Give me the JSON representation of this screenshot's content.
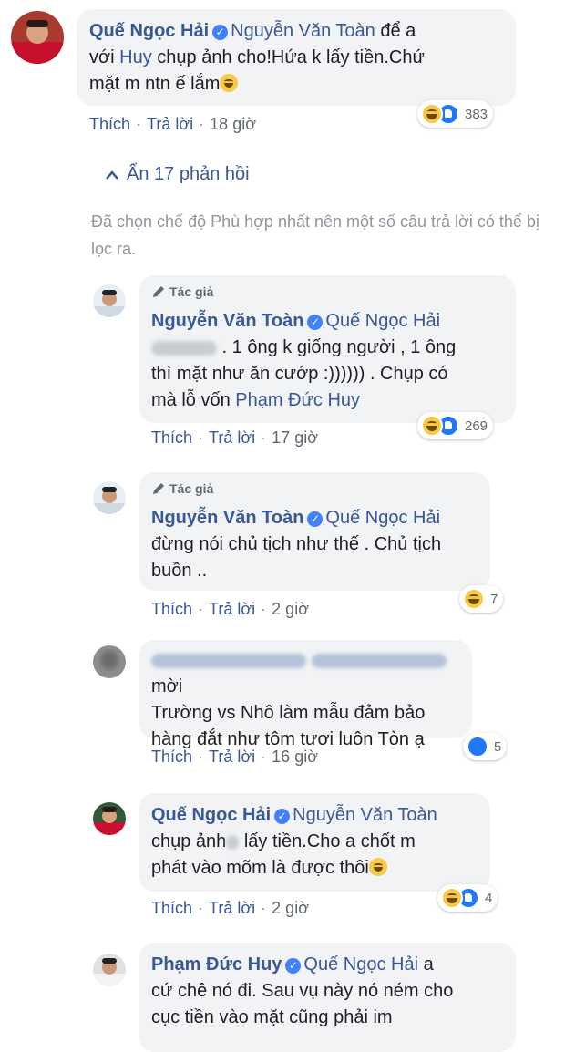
{
  "actions": {
    "like": "Thích",
    "reply": "Trả lời",
    "sep": "·"
  },
  "author_badge": "Tác giả",
  "replies_toggle": "Ẩn 17 phản hồi",
  "relevance_notice": "Đã chọn chế độ Phù hợp nhất nên một số câu trả lời có thể bị lọc ra.",
  "comments": [
    {
      "author": "Quế Ngọc Hải",
      "tag": "Nguyễn Văn Toàn",
      "text_1": "để a",
      "text_2": "với",
      "tag_2": "Huy",
      "text_3": "chụp ảnh cho!Hứa k lấy tiền.Chứ",
      "text_4": "mặt m ntn ế lắm",
      "time": "18 giờ",
      "reaction_count": "383"
    },
    {
      "author": "Nguyễn Văn Toàn",
      "tag": "Quế Ngọc Hải",
      "text_1": ". 1 ông k giống người , 1 ông",
      "text_2": "thì mặt như ăn cướp :)))))) . Chụp có",
      "text_3": "mà lỗ vốn",
      "tag_2": "Phạm Đức Huy",
      "time": "17 giờ",
      "reaction_count": "269"
    },
    {
      "author": "Nguyễn Văn Toàn",
      "tag": "Quế Ngọc Hải",
      "text_1": "đừng nói chủ tịch như thế . Chủ tịch",
      "text_2": "buồn ..",
      "time": "2 giờ",
      "reaction_count": "7"
    },
    {
      "text_1": "mời",
      "text_2": "Trường vs Nhô làm mẫu đảm bảo",
      "text_3": "hàng đắt như tôm tươi luôn Tòn ạ",
      "time": "16 giờ",
      "reaction_count": "5"
    },
    {
      "author": "Quế Ngọc Hải",
      "tag": "Nguyễn Văn Toàn",
      "text_1a": "chụp ảnh",
      "text_1b": "lấy tiền.Cho a chốt m",
      "text_2": "phát vào mõm là được thôi",
      "time": "2 giờ",
      "reaction_count": "4"
    },
    {
      "author": "Phạm Đức Huy",
      "tag": "Quế Ngọc Hải",
      "text_1": "a",
      "text_2": "cứ chê nó đi. Sau vụ này nó ném cho",
      "text_3": "cục tiền vào mặt cũng phải im"
    }
  ]
}
